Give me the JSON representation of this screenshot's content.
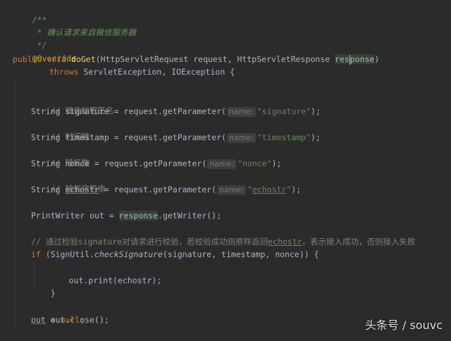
{
  "code": {
    "l1": "/**",
    "l2": " * 确认请求来自微信服务器",
    "l3": " */",
    "l4": "@Override",
    "l5": {
      "kw1": "public",
      "kw2": "void",
      "method": "doGet",
      "open": "(HttpServletRequest request, HttpServletResponse ",
      "param_a": "res",
      "param_b": "ponse",
      "close": ")"
    },
    "l6": {
      "kw": "throws",
      "rest": " ServletException, IOException {"
    },
    "l8": "// 微信加密签名",
    "l9": {
      "pre": "String signature = request.getParameter(",
      "hint": "name:",
      "str": "\"signature\"",
      "post": ");"
    },
    "l10": "// 时间戳",
    "l11": {
      "pre": "String timestamp = request.getParameter(",
      "hint": "name:",
      "str": "\"timestamp\"",
      "post": ");"
    },
    "l12": "// 随机数",
    "l13": {
      "pre": "String nonce = request.getParameter(",
      "hint": "name:",
      "str": "\"nonce\"",
      "post": ");"
    },
    "l14": "// 随机字符串",
    "l15": {
      "pre1": "String ",
      "var": "echostr",
      "pre2": " = request.getParameter(",
      "hint": "name:",
      "str_q1": "\"",
      "str_u": "echostr",
      "str_q2": "\"",
      "post": ");"
    },
    "l17": {
      "pre": "PrintWriter out = ",
      "var": "response",
      "post": ".getWriter();"
    },
    "l19": {
      "pre": "// 通过检验signature对请求进行校验，若校验成功则原样返回",
      "u": "echostr",
      "post": "，表示接入成功，否则接入失败"
    },
    "l20": {
      "kw": "if",
      "pre": " (SignUtil.",
      "static": "checkSignature",
      "post": "(signature, timestamp, nonce)) {"
    },
    "l21": "out.print(echostr);",
    "l22": "}",
    "l24": "out.close();",
    "l25": {
      "field": "out",
      "eq": " = ",
      "kw": "null",
      "semi": ";"
    },
    "l26": "}"
  },
  "watermark": "头条号 / souvc",
  "colors": {
    "background": "#2b2b2b",
    "keyword": "#cc7832",
    "string": "#6a8759",
    "comment": "#808080",
    "doc_comment": "#629755",
    "annotation": "#bbb529",
    "method": "#ffc66d",
    "text": "#a9b7c6"
  }
}
